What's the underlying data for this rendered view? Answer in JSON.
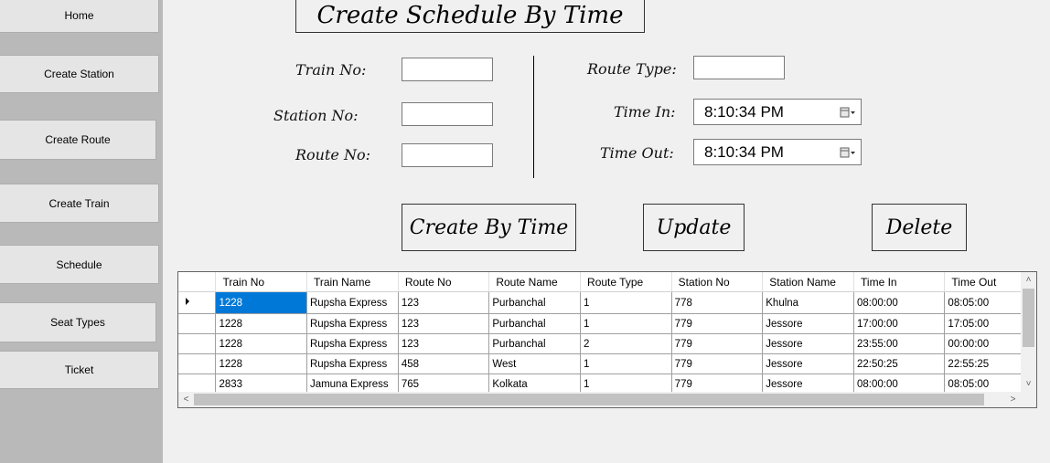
{
  "sidebar": {
    "items": [
      {
        "label": "Home"
      },
      {
        "label": "Create Station"
      },
      {
        "label": "Create Route"
      },
      {
        "label": "Create Train"
      },
      {
        "label": "Schedule"
      },
      {
        "label": "Seat Types"
      },
      {
        "label": "Ticket"
      }
    ]
  },
  "form": {
    "title": "Create Schedule By Time",
    "train_no_label": "Train No:",
    "station_no_label": "Station No:",
    "route_no_label": "Route No:",
    "route_type_label": "Route Type:",
    "time_in_label": "Time In:",
    "time_out_label": "Time Out:",
    "time_in_value": "8:10:34 PM",
    "time_out_value": "8:10:34 PM"
  },
  "actions": {
    "create": "Create By Time",
    "update": "Update",
    "delete": "Delete"
  },
  "grid": {
    "columns": [
      "Train No",
      "Train Name",
      "Route No",
      "Route Name",
      "Route Type",
      "Station No",
      "Station Name",
      "Time In",
      "Time Out"
    ],
    "rows": [
      [
        "1228",
        "Rupsha Express",
        "123",
        "Purbanchal",
        "1",
        "778",
        "Khulna",
        "08:00:00",
        "08:05:00"
      ],
      [
        "1228",
        "Rupsha Express",
        "123",
        "Purbanchal",
        "1",
        "779",
        "Jessore",
        "17:00:00",
        "17:05:00"
      ],
      [
        "1228",
        "Rupsha Express",
        "123",
        "Purbanchal",
        "2",
        "779",
        "Jessore",
        "23:55:00",
        "00:00:00"
      ],
      [
        "1228",
        "Rupsha Express",
        "458",
        "West",
        "1",
        "779",
        "Jessore",
        "22:50:25",
        "22:55:25"
      ],
      [
        "2833",
        "Jamuna Express",
        "765",
        "Kolkata",
        "1",
        "779",
        "Jessore",
        "08:00:00",
        "08:05:00"
      ]
    ]
  },
  "colors": {
    "sidebar_bg": "#b9b9b9",
    "selection": "#0078d7"
  }
}
